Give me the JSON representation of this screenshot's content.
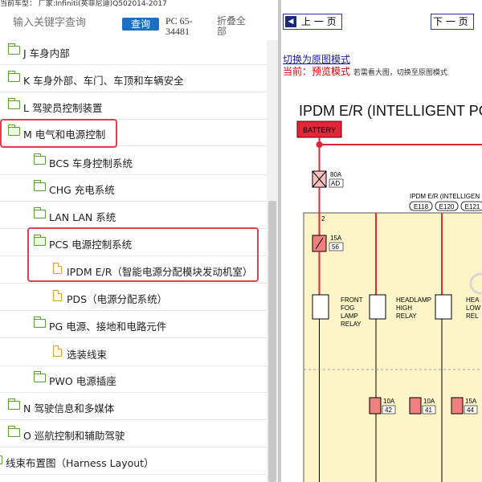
{
  "topbar": {
    "text": "当前车型：  厂家:Infiniti(英菲尼迪)Q502014-2017"
  },
  "search": {
    "placeholder": "输入关键字查询",
    "button": "查询",
    "code": "PC 65-34481",
    "collapse": "折叠全部"
  },
  "tree": [
    {
      "label": "J 车身内部",
      "icon": "folder"
    },
    {
      "label": "K 车身外部、车门、车顶和车辆安全",
      "icon": "folder"
    },
    {
      "label": "L 驾驶员控制装置",
      "icon": "folder"
    },
    {
      "label": "M 电气和电源控制",
      "icon": "folder-open"
    },
    {
      "label": "BCS 车身控制系统",
      "icon": "folder"
    },
    {
      "label": "CHG 充电系统",
      "icon": "folder"
    },
    {
      "label": "LAN LAN 系统",
      "icon": "folder"
    },
    {
      "label": "PCS 电源控制系统",
      "icon": "folder-open"
    },
    {
      "label": "IPDM E/R（智能电源分配模块发动机室）",
      "icon": "document"
    },
    {
      "label": "PDS（电源分配系统）",
      "icon": "document"
    },
    {
      "label": "PG 电源、接地和电路元件",
      "icon": "folder"
    },
    {
      "label": "选装线束",
      "icon": "document"
    },
    {
      "label": "PWO 电源插座",
      "icon": "folder"
    },
    {
      "label": "N 驾驶信息和多媒体",
      "icon": "folder"
    },
    {
      "label": "O 巡航控制和辅助驾驶",
      "icon": "folder"
    },
    {
      "label": "线束布置图（Harness Layout）",
      "icon": "folder"
    }
  ],
  "viewer": {
    "prev": "上 一 页",
    "next": "下 一 页",
    "switch_link": "切换为原图模式",
    "current_label": "当前：",
    "current_mode": "预览模式",
    "current_hint": "若需看大图，切换至原图模式",
    "diagram": {
      "title": "IPDM E/R (INTELLIGENT PO",
      "battery": "BATTERY",
      "fuse_main": "80A",
      "fuse_main_id": "AD",
      "module_label": "IPDM E/R (INTELLIGEN",
      "connectors": [
        "E118",
        "E120",
        "E121"
      ],
      "wire_num": "2",
      "fuse_15a": "15A",
      "fuse_15a_id": "56",
      "relay_front_fog": "FRONT FOG LAMP RELAY",
      "relay_headlamp_high": "HEADLAMP HIGH RELAY",
      "relay_headlamp_low": "HEA LOW REL",
      "fuses_bottom": [
        {
          "amp": "10A",
          "id": "42"
        },
        {
          "amp": "10A",
          "id": "41"
        },
        {
          "amp": "15A",
          "id": "44"
        }
      ]
    }
  },
  "colors": {
    "accent": "#1d6fc2",
    "highlight": "#e04050",
    "folder": "#5aa02c",
    "document": "#e0a040",
    "wire": "#e0263a",
    "fuse": "#f08080",
    "module_fill": "#fdf5c8"
  }
}
